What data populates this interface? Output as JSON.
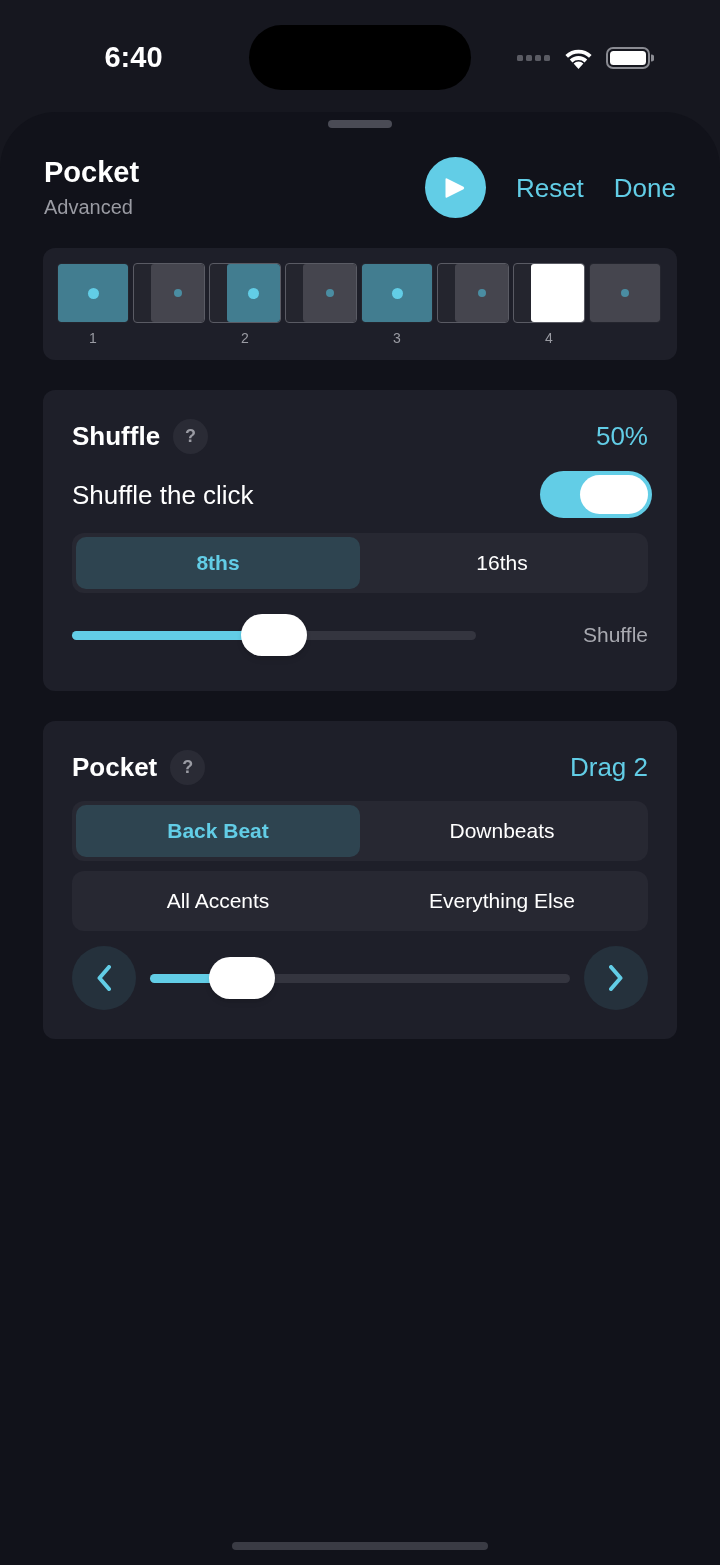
{
  "status_bar": {
    "time": "6:40"
  },
  "header": {
    "title": "Pocket",
    "subtitle": "Advanced",
    "actions": [
      "Reset",
      "Done"
    ]
  },
  "beat_strip": {
    "beats": [
      {
        "label": "1",
        "steps": [
          {
            "kind": "accent",
            "shifted": false
          },
          {
            "kind": "plain",
            "shifted": true
          }
        ]
      },
      {
        "label": "2",
        "steps": [
          {
            "kind": "accent",
            "shifted": true
          },
          {
            "kind": "plain",
            "shifted": true
          }
        ]
      },
      {
        "label": "3",
        "steps": [
          {
            "kind": "accent",
            "shifted": false
          },
          {
            "kind": "plain",
            "shifted": true
          }
        ]
      },
      {
        "label": "4",
        "steps": [
          {
            "kind": "current",
            "shifted": true
          },
          {
            "kind": "plain",
            "shifted": false
          }
        ]
      }
    ]
  },
  "shuffle": {
    "title": "Shuffle",
    "help": "?",
    "value": "50%",
    "toggle": {
      "label": "Shuffle the click",
      "on": true
    },
    "segments": [
      {
        "label": "8ths",
        "selected": true
      },
      {
        "label": "16ths",
        "selected": false
      }
    ],
    "slider": {
      "level": 0.5,
      "label": "Shuffle"
    }
  },
  "pocket": {
    "title": "Pocket",
    "help": "?",
    "value": "Drag 2",
    "segment_groups": [
      [
        {
          "label": "Back Beat",
          "selected": true
        },
        {
          "label": "Downbeats",
          "selected": false
        }
      ],
      [
        {
          "label": "All Accents",
          "selected": false
        },
        {
          "label": "Everything Else",
          "selected": false
        }
      ]
    ],
    "slider": {
      "level": 0.22
    }
  }
}
